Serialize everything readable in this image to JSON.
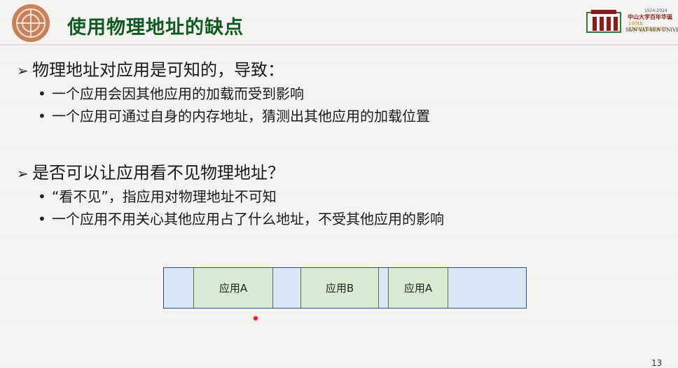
{
  "slide": {
    "title": "使用物理地址的缺点",
    "page_number": "13"
  },
  "university": {
    "years": "1924-2024",
    "name_cn": "中山大学百年华诞",
    "anniversary_en": "100th ANNIVERSARY",
    "name_en": "SUN YAT-SEN UNIVERSITY"
  },
  "sections": [
    {
      "heading": "物理地址对应用是可知的，导致：",
      "items": [
        "一个应用会因其他应用的加载而受到影响",
        "一个应用可通过自身的内存地址，猜测出其他应用的加载位置"
      ]
    },
    {
      "heading": "是否可以让应用看不见物理地址？",
      "items": [
        "“看不见”，指应用对物理地址不可知",
        "一个应用不用关心其他应用占了什么地址，不受其他应用的影响"
      ]
    }
  ],
  "memory_diagram": {
    "segments": [
      "应用A",
      "应用B",
      "应用A"
    ],
    "colors": {
      "free": "#dce8f8",
      "app": "#d9ead3",
      "border": "#2f4f87"
    }
  }
}
